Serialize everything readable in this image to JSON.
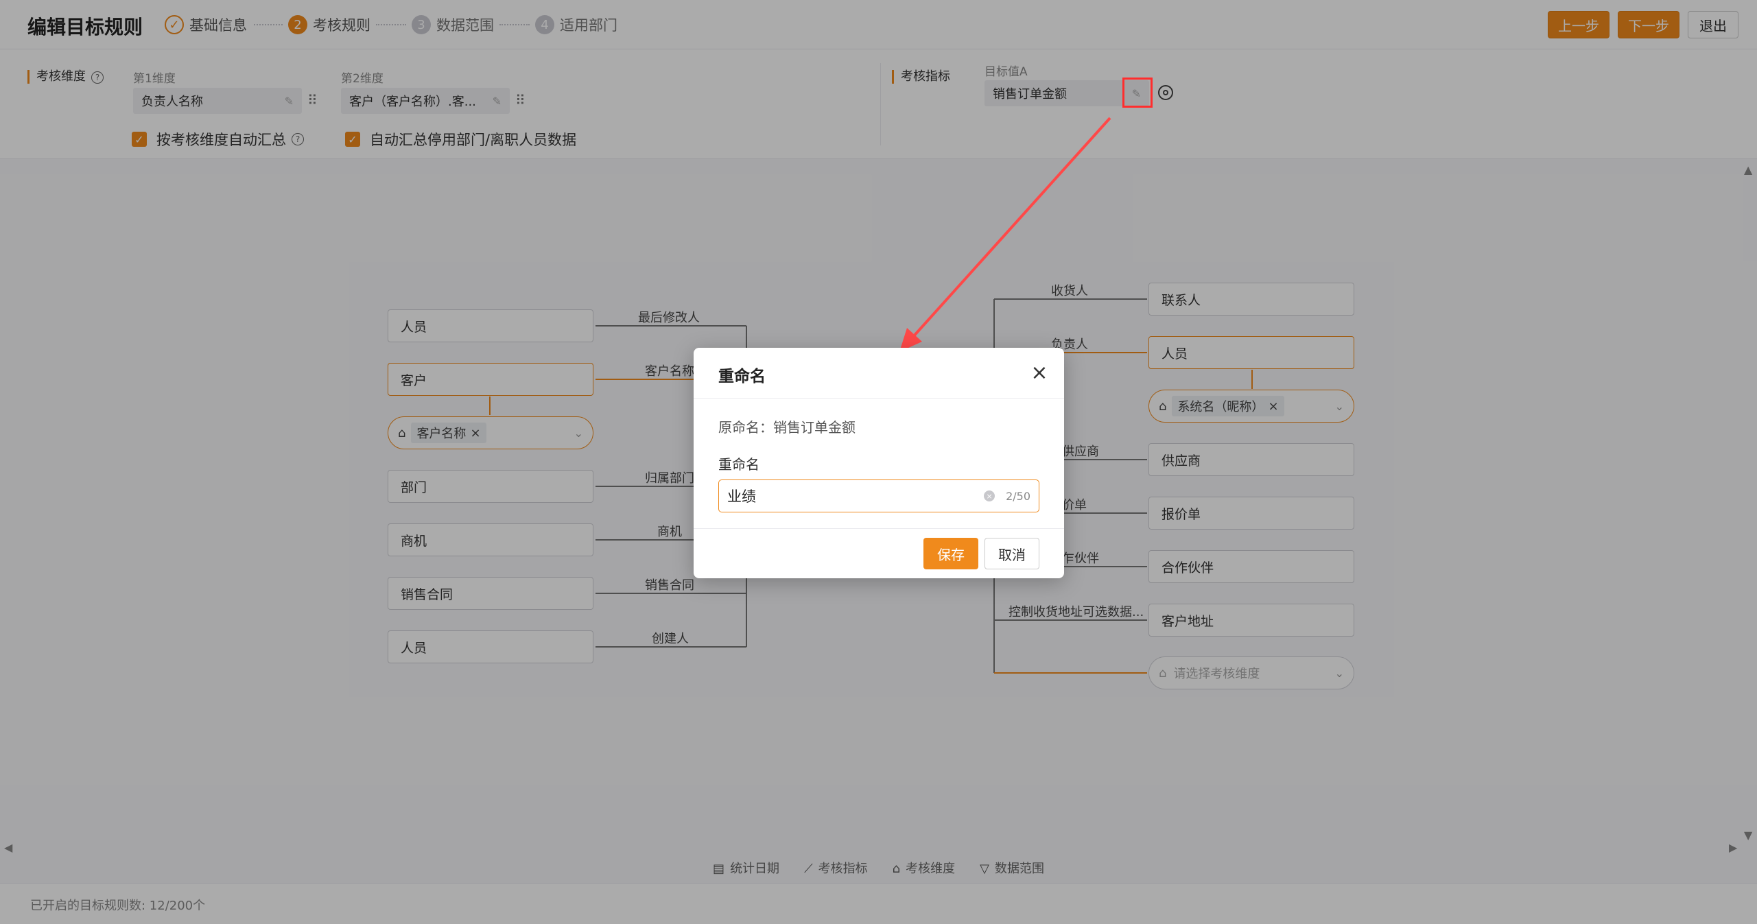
{
  "header": {
    "title": "编辑目标规则",
    "steps": [
      {
        "num": "✓",
        "label": "基础信息"
      },
      {
        "num": "2",
        "label": "考核规则"
      },
      {
        "num": "3",
        "label": "数据范围"
      },
      {
        "num": "4",
        "label": "适用部门"
      }
    ],
    "prev_label": "上一步",
    "next_label": "下一步",
    "exit_label": "退出"
  },
  "config": {
    "dimension_title": "考核维度",
    "dim1_label": "第1维度",
    "dim1_value": "负责人名称",
    "dim2_label": "第2维度",
    "dim2_value": "客户（客户名称）.客...",
    "auto_sum_label": "按考核维度自动汇总",
    "auto_sum_disabled_label": "自动汇总停用部门/离职人员数据",
    "indicator_title": "考核指标",
    "target_label": "目标值A",
    "target_value": "销售订单金额"
  },
  "graph": {
    "left_nodes": [
      {
        "label": "人员",
        "edge": "最后修改人"
      },
      {
        "label": "客户",
        "edge": "客户名称"
      },
      {
        "label": "部门",
        "edge": "归属部门"
      },
      {
        "label": "商机",
        "edge": "商机"
      },
      {
        "label": "销售合同",
        "edge": "销售合同"
      },
      {
        "label": "人员",
        "edge": "创建人"
      }
    ],
    "left_pill_tag": "客户名称",
    "right_nodes": [
      {
        "label": "联系人",
        "edge": "收货人"
      },
      {
        "label": "人员",
        "edge": "负责人"
      },
      {
        "label": "供应商",
        "edge": "供应商"
      },
      {
        "label": "报价单",
        "edge": "价单"
      },
      {
        "label": "合作伙伴",
        "edge": "乍伙伴"
      },
      {
        "label": "客户地址",
        "edge": "控制收货地址可选数据..."
      }
    ],
    "right_pill_tag": "系统名（昵称）",
    "right_empty_placeholder": "请选择考核维度"
  },
  "legend": [
    "统计日期",
    "考核指标",
    "考核维度",
    "数据范围"
  ],
  "footer": {
    "text": "已开启的目标规则数: 12/200个"
  },
  "dialog": {
    "title": "重命名",
    "original": "原命名：销售订单金额",
    "rename_label": "重命名",
    "input_value": "业绩",
    "counter": "2/50",
    "save_label": "保存",
    "cancel_label": "取消"
  },
  "colors": {
    "accent": "#f08a1c",
    "annotation": "#ff2d2d"
  },
  "icons": [
    "check-icon",
    "pencil-icon",
    "drag-handle-icon",
    "help-icon",
    "settings-icon",
    "hierarchy-icon",
    "close-icon",
    "chevron-down-icon",
    "calendar-icon",
    "chart-icon",
    "filter-icon"
  ]
}
